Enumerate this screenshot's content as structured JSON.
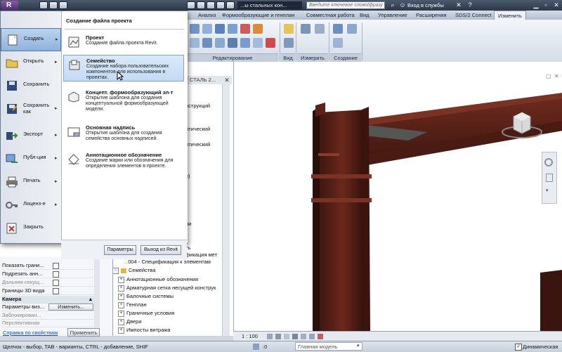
{
  "titlebar": {
    "document": "...ы стальных кон...",
    "search_placeholder": "Введите ключевое слово/фразу",
    "service": "Вход в службы"
  },
  "ribbon_tabs": [
    "Анализ",
    "Формообразующие и генплан",
    "Совместная работа",
    "Вид",
    "Управление",
    "Расширения",
    "SDS/2 Connect",
    "Изменить"
  ],
  "ribbon_groups": [
    "Редактирование",
    "Вид",
    "Измерить",
    "Создание"
  ],
  "app_menu": {
    "items": [
      {
        "label": "Создать",
        "icon": "new-icon",
        "arrow": true,
        "active": true
      },
      {
        "label": "Открыть",
        "icon": "open-folder-icon",
        "arrow": true
      },
      {
        "label": "Сохранить",
        "icon": "save-icon",
        "arrow": false
      },
      {
        "label": "Сохранить как",
        "icon": "save-as-icon",
        "arrow": true
      },
      {
        "label": "Экспорт",
        "icon": "export-icon",
        "arrow": true
      },
      {
        "label": "Публ-ция",
        "icon": "publish-icon",
        "arrow": true
      },
      {
        "label": "Печать",
        "icon": "print-icon",
        "arrow": true
      },
      {
        "label": "Лиценз-е",
        "icon": "license-key-icon",
        "arrow": true
      },
      {
        "label": "Закрыть",
        "icon": "close-doc-icon",
        "arrow": false
      }
    ],
    "heading": "Создание файла проекта",
    "options": [
      {
        "title": "Проект",
        "desc": "Создание файла проекта Revit."
      },
      {
        "title": "Семейство",
        "desc": "Создание набора пользовательских компонентов для использования в проектах."
      },
      {
        "title": "Концепт. формообразующий эл-т",
        "desc": "Открытие шаблона для создания концептуальной формообразующей модели."
      },
      {
        "title": "Основная надпись",
        "desc": "Открытие шаблона для создания семейства основных надписей."
      },
      {
        "title": "Аннотационное обозначение",
        "desc": "Создание марки или обозначения для определения элементов в проекте."
      }
    ],
    "params_button": "Параметры",
    "exit_button": "Выход из Revit"
  },
  "project_browser": {
    "header": "ИТ СТАЛЬ 2...",
    "partial_rows": [
      "нструкций",
      "итический",
      "итический",
      "я)",
      "ии",
      "ть",
      "фикация мет"
    ],
    "schedule_item": "004 - Спецификация к элементам",
    "families_label": "Семейства",
    "families": [
      "Аннотационные обозначения",
      "Арматурная сетка несущей конструк",
      "Балочные системы",
      "Генплан",
      "Граничные условия",
      "Двери",
      "Импосты витража"
    ]
  },
  "properties": {
    "rows": [
      {
        "label": "Показать грани...",
        "checkbox": true,
        "gray": false
      },
      {
        "label": "Подрезать анн...",
        "checkbox": true,
        "gray": false
      },
      {
        "label": "Дальняя секущ...",
        "checkbox": true,
        "gray": true
      },
      {
        "label": "Границы 3D вида",
        "checkbox": true,
        "gray": false
      }
    ],
    "camera_label": "Камера",
    "view_params_label": "Параметры виз...",
    "edit_button": "Изменить...",
    "locked_label": "Заблокирован...",
    "perspective_label": "Перспективная",
    "help_link": "Справка по свойствам",
    "apply_button": "Применить"
  },
  "viewbar": {
    "scale": "1 : 100"
  },
  "statusbar": {
    "hint": "Щелчок - выбор, TAB - варианты, CTRL - добавление, SHIF",
    "model": "Главная модель",
    "dynamic": "Динамическая",
    "zero": ":0"
  }
}
